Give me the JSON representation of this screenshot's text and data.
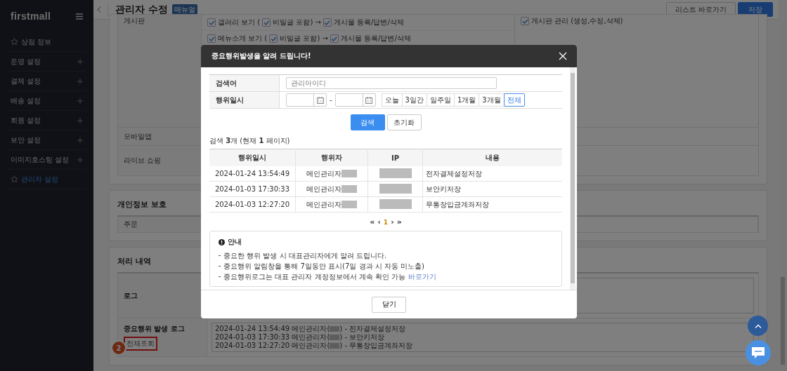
{
  "sidebar": {
    "logo": "firstmall",
    "items": [
      {
        "label": "상점 정보",
        "kind": "star",
        "selected": false
      },
      {
        "label": "운영 설정",
        "kind": "expand",
        "selected": false
      },
      {
        "label": "결제 설정",
        "kind": "expand",
        "selected": false
      },
      {
        "label": "배송 설정",
        "kind": "expand",
        "selected": false
      },
      {
        "label": "회원 설정",
        "kind": "expand",
        "selected": false
      },
      {
        "label": "보안 설정",
        "kind": "expand",
        "selected": false
      },
      {
        "label": "이미지호스팅 설정",
        "kind": "expand",
        "selected": false
      },
      {
        "label": "관리자 설정",
        "kind": "star",
        "selected": true
      }
    ]
  },
  "header": {
    "title": "관리자 수정",
    "badge": "매뉴얼",
    "buttons": [
      {
        "label": "리스트 바로가기",
        "kind": "secondary"
      },
      {
        "label": "저장",
        "kind": "primary"
      }
    ]
  },
  "permissions": {
    "rows": [
      {
        "label": "게시판",
        "lines": [
          [
            {
              "label": "갤러리 보기 (",
              "checked": true
            },
            {
              "label": "비밀글 포함) →",
              "checked": true
            },
            {
              "label": "게시물 등록/답변/삭제",
              "checked": true
            }
          ],
          [
            {
              "label": "메뉴소개 보기 (",
              "checked": true
            },
            {
              "label": "비밀글 포함) →",
              "checked": true
            },
            {
              "label": "게시물 등록/답변/삭제",
              "checked": true
            }
          ]
        ],
        "side": [
          {
            "label": "게시판 관리 (생성,수정,삭제)",
            "checked": true
          }
        ]
      },
      {
        "label": "모바일앱",
        "lines": [],
        "side": []
      },
      {
        "label": "라이브 쇼핑",
        "lines": [],
        "side": []
      }
    ]
  },
  "privacy": {
    "title": "개인정보 보호",
    "rows": [
      {
        "label": "주문"
      }
    ]
  },
  "history": {
    "title": "처리 내역",
    "log_label": "로그",
    "important_label": "중요행위 발생 로그",
    "view_all": "전체조회",
    "step": "2",
    "logs": [
      {
        "time": "2024-01-24 13:54:49",
        "actor": "메인관리자(",
        "after": ") - 전자결제설정저장"
      },
      {
        "time": "2024-01-03 17:30:33",
        "actor": "메인관리자(",
        "after": ") - 보안키저장"
      },
      {
        "time": "2024-01-03 12:27:20",
        "actor": "메인관리자(",
        "after": ") - 무통장입금계좌저장"
      }
    ]
  },
  "modal": {
    "title": "중요행위발생을 알려 드립니다!",
    "search": {
      "keyword_label": "검색어",
      "keyword_placeholder": "관리아이디",
      "date_label": "행위일시",
      "date_separator": "-",
      "periods": [
        {
          "label": "오늘",
          "selected": false
        },
        {
          "label": "3일간",
          "selected": false
        },
        {
          "label": "일주일",
          "selected": false
        },
        {
          "label": "1개월",
          "selected": false
        },
        {
          "label": "3개월",
          "selected": false
        },
        {
          "label": "전체",
          "selected": true
        }
      ],
      "buttons": [
        {
          "label": "검색",
          "kind": "primary"
        },
        {
          "label": "초기화",
          "kind": "secondary"
        }
      ]
    },
    "summary": "검색 **3**개 (현재 **1** 페이지)",
    "columns": [
      "행위일시",
      "행위자",
      "IP",
      "내용"
    ],
    "rows": [
      {
        "time": "2024-01-24 13:54:49",
        "actor": "메인관리자",
        "content": "전자결제설정저장"
      },
      {
        "time": "2024-01-03 17:30:33",
        "actor": "메인관리자",
        "content": "보안키저장"
      },
      {
        "time": "2024-01-03 12:27:20",
        "actor": "메인관리자",
        "content": "무통장입금계좌저장"
      }
    ],
    "pagination": [
      {
        "label": "«",
        "kind": "arrow",
        "selected": false
      },
      {
        "label": "‹",
        "kind": "arrow",
        "selected": false
      },
      {
        "label": "1",
        "kind": "page",
        "selected": true
      },
      {
        "label": "›",
        "kind": "arrow",
        "selected": false
      },
      {
        "label": "»",
        "kind": "arrow",
        "selected": false
      }
    ],
    "notice": {
      "title": "안내",
      "lines": [
        {
          "text": "중요한 행위 발생 시 대표관리자에게 알려 드립니다."
        },
        {
          "text": "중요행위 알림창을 통해 7일동안 표시(7일 경과 시 자동 미노출)"
        },
        {
          "text": "중요행위로그는 대표 관리자 계정정보에서 계속 확인 가능",
          "link": "바로가기"
        }
      ]
    },
    "close_button": "닫기"
  }
}
